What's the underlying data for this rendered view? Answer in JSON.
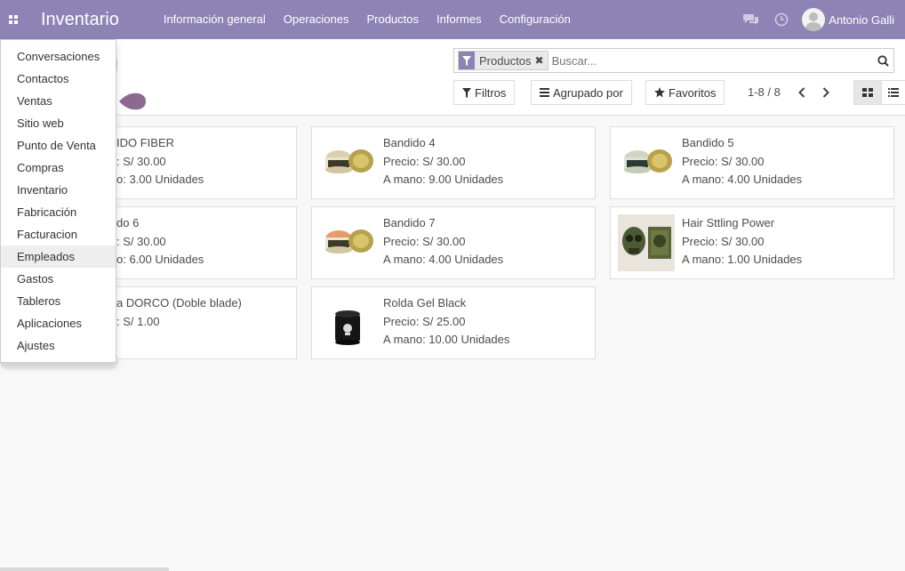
{
  "app": {
    "title": "Inventario",
    "menu": [
      "Información general",
      "Operaciones",
      "Productos",
      "Informes",
      "Configuración"
    ],
    "user_name": "Antonio Galli",
    "icons": {
      "apps": "apps-grid-icon",
      "chat": "chat-icon",
      "activity": "clock-icon"
    },
    "brand_color": "#8d84b5"
  },
  "search": {
    "facet_label": "Productos",
    "placeholder": "Buscar..."
  },
  "controls": {
    "filters_label": "Filtros",
    "group_label": "Agrupado por",
    "favorites_label": "Favoritos",
    "pager": "1-8 / 8"
  },
  "products": [
    {
      "name": "BANDIDO FIBER",
      "name_visible": "IDO FIBER",
      "price_visible": ": S/ 30.00",
      "qty_visible": "o: 3.00 Unidades"
    },
    {
      "name": "Bandido 4",
      "price": "Precio: S/ 30.00",
      "qty": "A mano: 9.00 Unidades"
    },
    {
      "name": "Bandido 5",
      "price": "Precio: S/ 30.00",
      "qty": "A mano: 4.00 Unidades"
    },
    {
      "name_visible": "do 6",
      "price_visible": ": S/ 30.00",
      "qty_visible": "o: 6.00 Unidades"
    },
    {
      "name": "Bandido 7",
      "price": "Precio: S/ 30.00",
      "qty": "A mano: 4.00 Unidades"
    },
    {
      "name": "Hair Sttling Power",
      "price": "Precio: S/ 30.00",
      "qty": "A mano: 1.00 Unidades"
    },
    {
      "name_visible": "a DORCO (Doble blade)",
      "price_visible": ": S/ 1.00"
    },
    {
      "name": "Rolda Gel Black",
      "price": "Precio: S/ 25.00",
      "qty": "A mano: 10.00 Unidades"
    }
  ],
  "apps_menu": [
    "Conversaciones",
    "Contactos",
    "Ventas",
    "Sitio web",
    "Punto de Venta",
    "Compras",
    "Inventario",
    "Fabricación",
    "Facturacion",
    "Empleados",
    "Gastos",
    "Tableros",
    "Aplicaciones",
    "Ajustes"
  ]
}
